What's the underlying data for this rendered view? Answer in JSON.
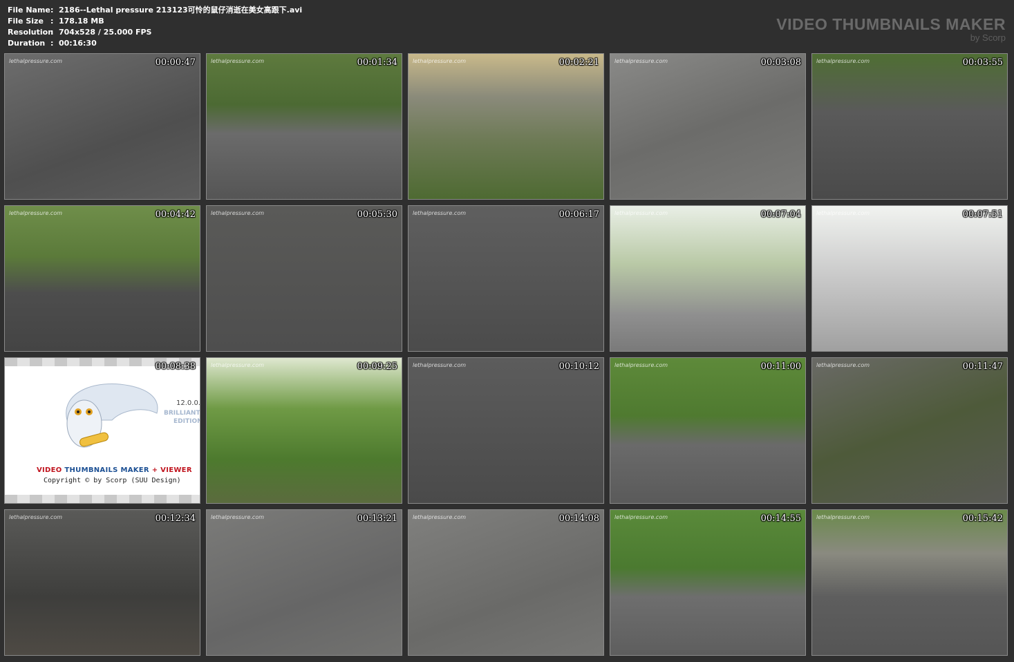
{
  "info": {
    "file_name": {
      "label": "File Name",
      "value": "2186--Lethal pressure 213123可怜的鼠仔消逝在美女高跟下.avi"
    },
    "file_size": {
      "label": "File Size",
      "value": "178.18 MB"
    },
    "resolution": {
      "label": "Resolution",
      "value": "704x528 / 25.000 FPS"
    },
    "duration": {
      "label": "Duration",
      "value": "00:16:30"
    }
  },
  "brand": {
    "title": "VIDEO THUMBNAILS MAKER",
    "subtitle": "by Scorp"
  },
  "watermark": "lethalpressure.com",
  "splash": {
    "brand_a": "VIDEO ",
    "brand_b": "THUMBNAILS MAKER",
    "brand_c": " + VIEWER",
    "copyright": "Copyright © by Scorp (SUU Design)",
    "version": "12.0.0.",
    "edition_1": "BRILLIANT",
    "edition_2": "EDITION"
  },
  "thumbnails": [
    {
      "time": "00:00:47"
    },
    {
      "time": "00:01:34"
    },
    {
      "time": "00:02:21"
    },
    {
      "time": "00:03:08"
    },
    {
      "time": "00:03:55"
    },
    {
      "time": "00:04:42"
    },
    {
      "time": "00:05:30"
    },
    {
      "time": "00:06:17"
    },
    {
      "time": "00:07:04"
    },
    {
      "time": "00:07:51"
    },
    {
      "time": "00:08:38"
    },
    {
      "time": "00:09:25"
    },
    {
      "time": "00:10:12"
    },
    {
      "time": "00:11:00"
    },
    {
      "time": "00:11:47"
    },
    {
      "time": "00:12:34"
    },
    {
      "time": "00:13:21"
    },
    {
      "time": "00:14:08"
    },
    {
      "time": "00:14:55"
    },
    {
      "time": "00:15:42"
    }
  ],
  "colors": {
    "page_bg": "#2f2f2f",
    "brand": "#6a6a6a",
    "thumb_border": "#8a8a8a"
  }
}
